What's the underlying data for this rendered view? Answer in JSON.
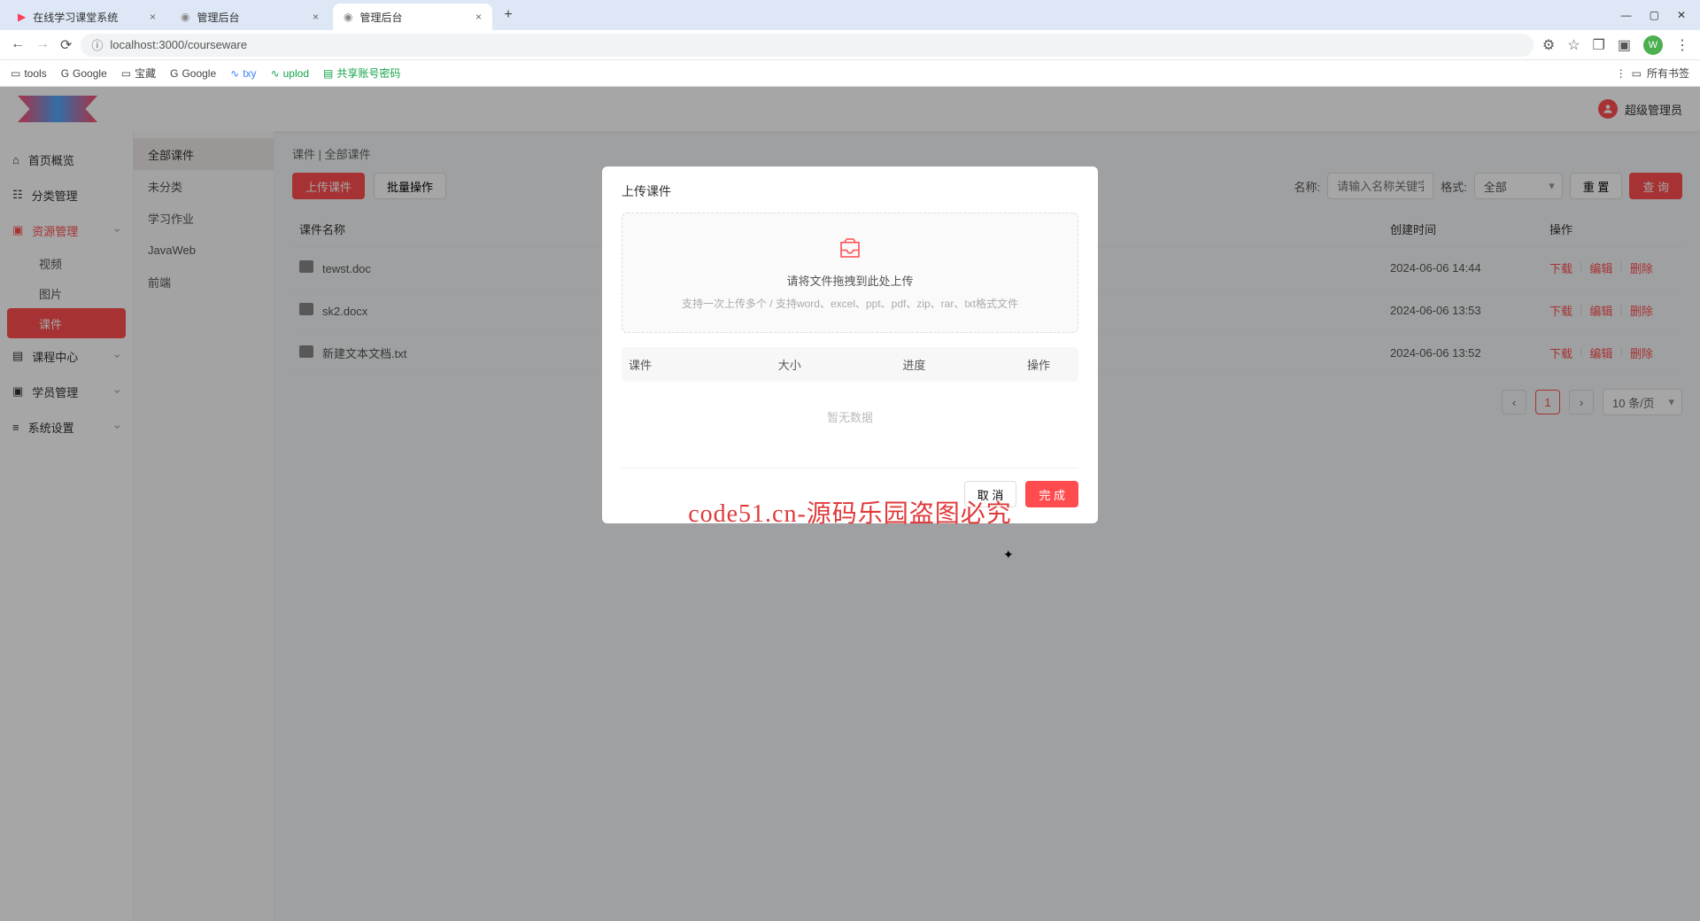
{
  "browser": {
    "tabs": [
      {
        "title": "在线学习课堂系统",
        "icon_color": "#ff3b5c"
      },
      {
        "title": "管理后台",
        "icon_color": "#888"
      },
      {
        "title": "管理后台",
        "icon_color": "#888"
      }
    ],
    "url": "localhost:3000/courseware",
    "url_prefix_icon": "ⓘ",
    "avatar_letter": "W",
    "bookmarks": [
      "tools",
      "Google",
      "宝藏",
      "Google",
      "txy",
      "uplod",
      "共享账号密码"
    ],
    "all_bookmarks_label": "所有书签"
  },
  "header": {
    "user_name": "超级管理员"
  },
  "sidebar": {
    "items": [
      {
        "label": "首页概览",
        "icon": "home-icon"
      },
      {
        "label": "分类管理",
        "icon": "category-icon"
      },
      {
        "label": "资源管理",
        "icon": "folder-icon",
        "active": true,
        "children": [
          {
            "label": "视频"
          },
          {
            "label": "图片"
          },
          {
            "label": "课件",
            "active": true
          }
        ]
      },
      {
        "label": "课程中心",
        "icon": "chat-icon",
        "expandable": true
      },
      {
        "label": "学员管理",
        "icon": "user-icon",
        "expandable": true
      },
      {
        "label": "系统设置",
        "icon": "gear-icon",
        "expandable": true
      }
    ]
  },
  "categories": {
    "items": [
      "全部课件",
      "未分类",
      "学习作业",
      "JavaWeb",
      "前端"
    ],
    "active_index": 0
  },
  "breadcrumb": "课件 | 全部课件",
  "toolbar": {
    "upload_label": "上传课件",
    "batch_label": "批量操作",
    "name_label": "名称:",
    "name_placeholder": "请输入名称关键字",
    "format_label": "格式:",
    "format_value": "全部",
    "reset_label": "重 置",
    "query_label": "查 询"
  },
  "table": {
    "columns": {
      "name": "课件名称",
      "time": "创建时间",
      "op": "操作"
    },
    "rows": [
      {
        "name": "tewst.doc",
        "time": "2024-06-06 14:44"
      },
      {
        "name": "sk2.docx",
        "time": "2024-06-06 13:53"
      },
      {
        "name": "新建文本文档.txt",
        "time": "2024-06-06 13:52"
      }
    ],
    "ops": {
      "download": "下载",
      "edit": "编辑",
      "delete": "删除"
    }
  },
  "pagination": {
    "current": "1",
    "size_label": "10 条/页"
  },
  "modal": {
    "title": "上传课件",
    "drop_text": "请将文件拖拽到此处上传",
    "drop_hint": "支持一次上传多个 / 支持word、excel、ppt、pdf、zip、rar、txt格式文件",
    "columns": {
      "name": "课件",
      "size": "大小",
      "progress": "进度",
      "op": "操作"
    },
    "empty_text": "暂无数据",
    "cancel_label": "取 消",
    "confirm_label": "完 成"
  },
  "watermark_text": "code51.cn",
  "overlay_text": "code51.cn-源码乐园盗图必究"
}
